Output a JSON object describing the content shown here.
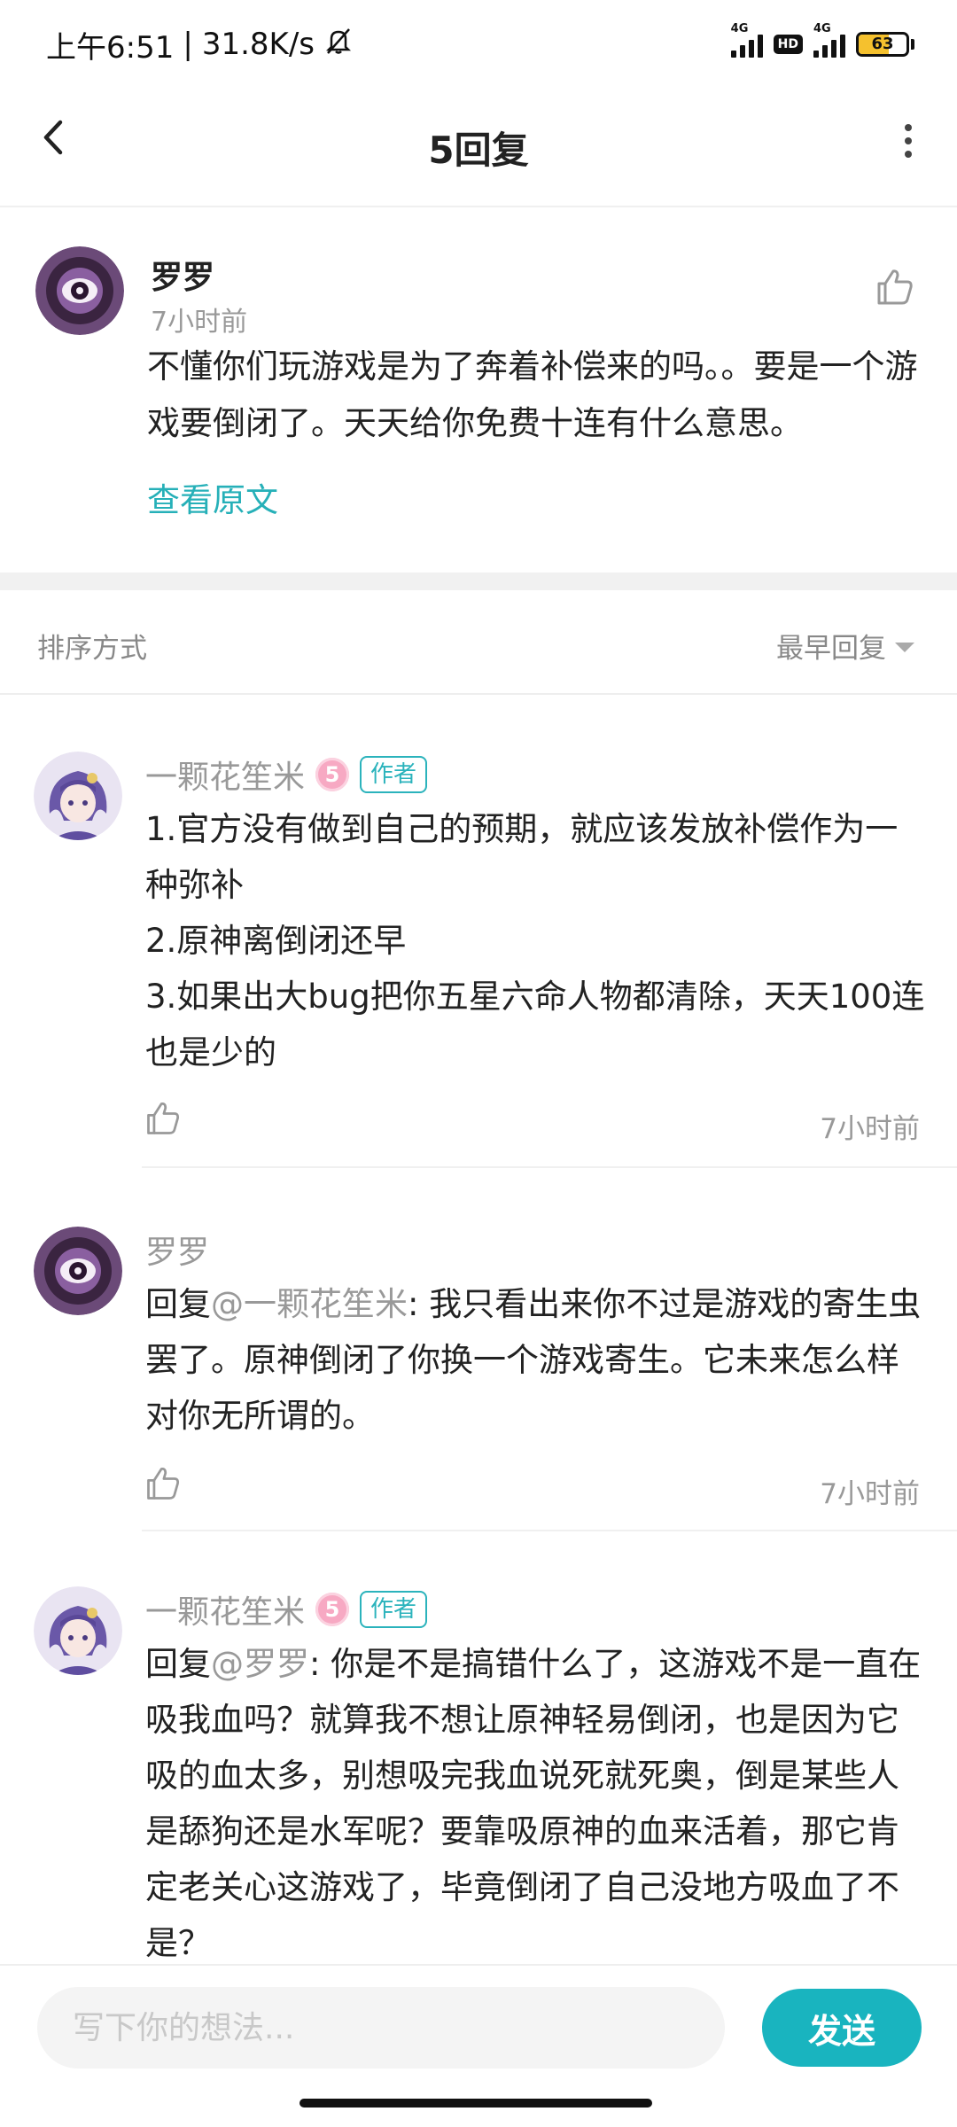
{
  "status_bar": {
    "time": "上午6:51",
    "speed": "31.8K/s",
    "network_1": "4G",
    "hd": "HD",
    "network_2": "4G",
    "battery": "63",
    "battery_level": 0.63
  },
  "header": {
    "title": "5回复"
  },
  "post": {
    "author": "罗罗",
    "time": "7小时前",
    "content": "不懂你们玩游戏是为了奔着补偿来的吗。。要是一个游戏要倒闭了。天天给你免费十连有什么意思。",
    "view_original": "查看原文"
  },
  "sort": {
    "label": "排序方式",
    "order": "最早回复"
  },
  "replies": [
    {
      "author": "一颗花笙米",
      "level": "5",
      "badge": "作者",
      "text": "1.官方没有做到自己的预期，就应该发放补偿作为一种弥补\n2.原神离倒闭还早\n3.如果出大bug把你五星六命人物都清除，天天100连也是少的",
      "time": "7小时前"
    },
    {
      "author": "罗罗",
      "mention": "@一颗花笙米",
      "reply_prefix": "回复",
      "text": ": 我只看出来你不过是游戏的寄生虫罢了。原神倒闭了你换一个游戏寄生。它未来怎么样对你无所谓的。",
      "time": "7小时前"
    },
    {
      "author": "一颗花笙米",
      "level": "5",
      "badge": "作者",
      "mention": "@罗罗",
      "reply_prefix": "回复",
      "text": ": 你是不是搞错什么了，这游戏不是一直在吸我血吗？就算我不想让原神轻易倒闭，也是因为它吸的血太多，别想吸完我血说死就死奥，倒是某些人是舔狗还是水军呢？要靠吸原神的血来活着，那它肯定老关心这游戏了，毕竟倒闭了自己没地方吸血了不是？"
    }
  ],
  "input": {
    "placeholder": "写下你的想法...",
    "send_label": "发送"
  },
  "colors": {
    "accent": "#19b4bf",
    "link": "#26b0b8",
    "muted": "#999999"
  }
}
